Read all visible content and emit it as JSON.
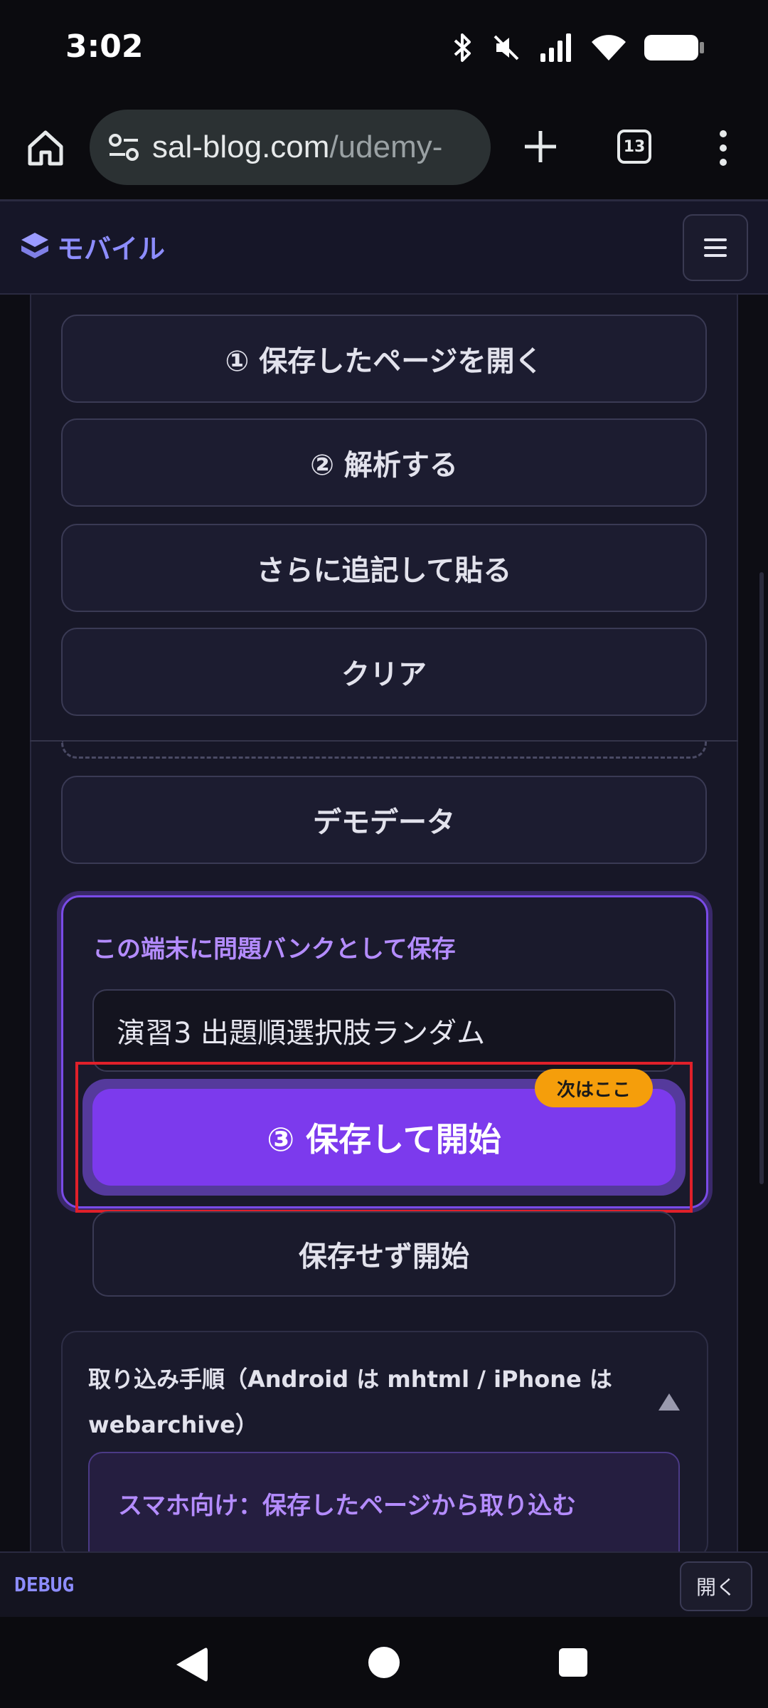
{
  "status_bar": {
    "time": "3:02",
    "icons": [
      "bluetooth-icon",
      "mute-icon",
      "signal-icon",
      "wifi-icon",
      "battery-icon"
    ]
  },
  "browser": {
    "url_host": "sal-blog.com",
    "url_path": "/udemy-",
    "tab_count": "13"
  },
  "app_header": {
    "logo_text": "モバイル",
    "accent_color": "#8d8dff"
  },
  "main": {
    "buttons": {
      "open_saved": "① 保存したページを開く",
      "analyze": "② 解析する",
      "append_paste": "さらに追記して貼る",
      "clear": "クリア",
      "demo_data": "デモデータ"
    },
    "save_section": {
      "title": "この端末に問題バンクとして保存",
      "name_value": "演習3 出題順選択肢ランダム",
      "next_badge": "次はここ",
      "save_start_label": "③ 保存して開始",
      "start_without_save_label": "保存せず開始",
      "primary_color": "#7c3aed",
      "badge_color": "#f59e0b"
    },
    "import_section": {
      "title": "取り込み手順（Android は mhtml / iPhone は webarchive）",
      "subcard_title": "スマホ向け：保存したページから取り込む"
    }
  },
  "debug": {
    "label": "DEBUG",
    "open_button": "開く"
  }
}
